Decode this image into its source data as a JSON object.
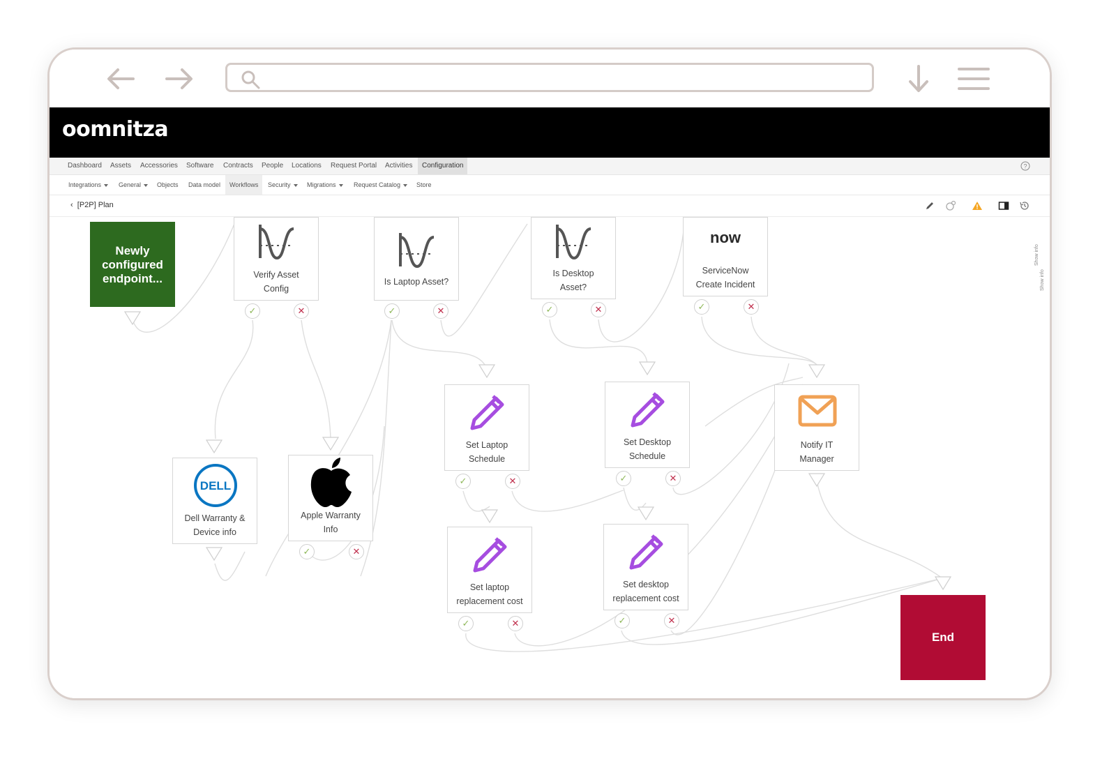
{
  "browser": {
    "search_placeholder": ""
  },
  "app": {
    "logo": "oomnitza"
  },
  "top_nav": {
    "items": [
      "Dashboard",
      "Assets",
      "Accessories",
      "Software",
      "Contracts",
      "People",
      "Locations",
      "Request Portal",
      "Activities",
      "Configuration"
    ],
    "active": "Configuration"
  },
  "sub_nav": {
    "items": [
      "Integrations",
      "General",
      "Objects",
      "Data model",
      "Workflows",
      "Security",
      "Migrations",
      "Request Catalog",
      "Store"
    ],
    "active": "Workflows"
  },
  "toolbar": {
    "back_label": "[P2P] Plan"
  },
  "side": {
    "show_info": "Show info"
  },
  "workflow": {
    "start": {
      "label": "Newly configured endpoint..."
    },
    "end": {
      "label": "End"
    },
    "nodes": {
      "verify_asset_config": {
        "label1": "Verify Asset",
        "label2": "Config",
        "icon": "condition-icon"
      },
      "is_laptop_asset": {
        "label1": "Is Laptop Asset?",
        "icon": "condition-icon"
      },
      "is_desktop_asset": {
        "label1": "Is Desktop",
        "label2": "Asset?",
        "icon": "condition-icon"
      },
      "servicenow_create_incident": {
        "label1": "ServiceNow",
        "label2": "Create Incident",
        "icon": "servicenow-logo",
        "logo_text": "now"
      },
      "dell_warranty": {
        "label1": "Dell Warranty &",
        "label2": "Device info",
        "icon": "dell-logo",
        "logo_text": "DELL"
      },
      "apple_warranty": {
        "label1": "Apple Warranty",
        "label2": "Info",
        "icon": "apple-logo"
      },
      "set_laptop_schedule": {
        "label1": "Set Laptop",
        "label2": "Schedule",
        "icon": "pencil-icon"
      },
      "set_desktop_schedule": {
        "label1": "Set Desktop",
        "label2": "Schedule",
        "icon": "pencil-icon"
      },
      "notify_it_manager": {
        "label1": "Notify IT",
        "label2": "Manager",
        "icon": "mail-icon"
      },
      "set_laptop_replacement_cost": {
        "label1": "Set laptop",
        "label2": "replacement cost",
        "icon": "pencil-icon"
      },
      "set_desktop_replacement_cost": {
        "label1": "Set desktop",
        "label2": "replacement cost",
        "icon": "pencil-icon"
      }
    },
    "port_symbols": {
      "success": "✓",
      "failure": "✕"
    }
  },
  "colors": {
    "start": "#2d6a1f",
    "end": "#b10c34",
    "pencil": "#a64de0",
    "mail": "#f0a155",
    "success": "#8fb85a",
    "failure": "#c0304d",
    "header": "#000000"
  }
}
